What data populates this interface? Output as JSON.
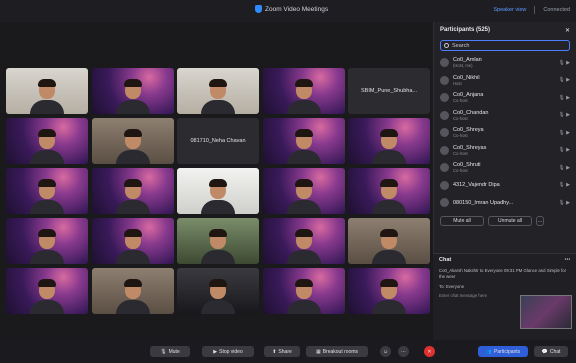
{
  "window": {
    "title": "Zoom Video Meetings",
    "right": {
      "speaker": "Speaker view",
      "status": "Connected"
    }
  },
  "grid": {
    "tiles": [
      {
        "bg": "bg-light",
        "label": ""
      },
      {
        "bg": "bg-purple",
        "label": ""
      },
      {
        "bg": "bg-light",
        "label": ""
      },
      {
        "bg": "bg-purple",
        "label": ""
      },
      {
        "bg": "",
        "label": "SBIM_Pune_Shubha..."
      },
      {
        "bg": "bg-purple",
        "label": ""
      },
      {
        "bg": "bg-room",
        "label": ""
      },
      {
        "bg": "",
        "label": "081710_Neha Chavan"
      },
      {
        "bg": "bg-purple",
        "label": ""
      },
      {
        "bg": "bg-purple",
        "label": ""
      },
      {
        "bg": "bg-purple",
        "label": ""
      },
      {
        "bg": "bg-purple",
        "label": ""
      },
      {
        "bg": "bg-white",
        "label": ""
      },
      {
        "bg": "bg-purple",
        "label": ""
      },
      {
        "bg": "bg-purple",
        "label": ""
      },
      {
        "bg": "bg-purple",
        "label": ""
      },
      {
        "bg": "bg-purple",
        "label": ""
      },
      {
        "bg": "bg-green",
        "label": ""
      },
      {
        "bg": "bg-purple",
        "label": ""
      },
      {
        "bg": "bg-room",
        "label": ""
      },
      {
        "bg": "bg-purple",
        "label": ""
      },
      {
        "bg": "bg-room",
        "label": ""
      },
      {
        "bg": "bg-dark",
        "label": ""
      },
      {
        "bg": "bg-purple",
        "label": ""
      },
      {
        "bg": "bg-purple",
        "label": ""
      }
    ]
  },
  "participants": {
    "header": "Participants (525)",
    "search_value": "Search",
    "rows": [
      {
        "name": "Co0_Amlan",
        "sub": "(Host, me)"
      },
      {
        "name": "Co0_Nikhil",
        "sub": "Host"
      },
      {
        "name": "Co0_Anjana",
        "sub": "Co-host"
      },
      {
        "name": "Co0_Chandan",
        "sub": "Co-host"
      },
      {
        "name": "Co0_Shreya",
        "sub": "Co-host"
      },
      {
        "name": "Co0_Shreyas",
        "sub": "Co-host"
      },
      {
        "name": "Co0_Shruti",
        "sub": "Co-host"
      },
      {
        "name": "4312_Vajendr Dipa",
        "sub": ""
      },
      {
        "name": "080150_Imran Upadhy...",
        "sub": ""
      }
    ],
    "buttons": {
      "mute_all": "Mute all",
      "unmute_all": "Unmute all",
      "more": "..."
    }
  },
  "chat": {
    "header": "Chat",
    "message": "Co0_Akarsh Nakshtr to Everyone 09:31 PM  Glance and Simple for the weer",
    "to_label": "To:",
    "to_value": "Everyone",
    "input_placeholder": "Enter chat message here"
  },
  "toolbar": {
    "mute": "Mute",
    "stop_video": "Stop video",
    "share": "Share",
    "breakout": "Breakout rooms",
    "participants": "Participants",
    "chat": "Chat"
  }
}
